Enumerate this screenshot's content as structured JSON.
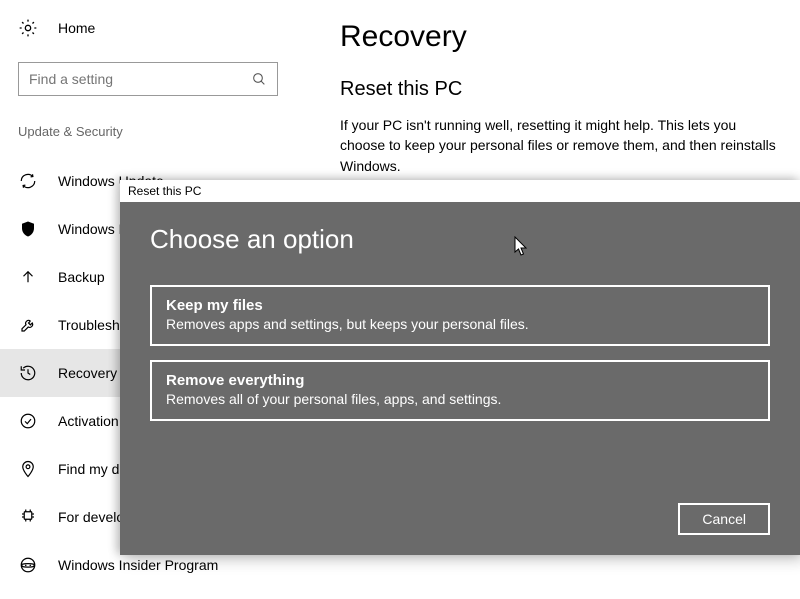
{
  "sidebar": {
    "home_label": "Home",
    "search_placeholder": "Find a setting",
    "section_label": "Update & Security",
    "items": [
      {
        "label": "Windows Update"
      },
      {
        "label": "Windows Defender"
      },
      {
        "label": "Backup"
      },
      {
        "label": "Troubleshoot"
      },
      {
        "label": "Recovery"
      },
      {
        "label": "Activation"
      },
      {
        "label": "Find my device"
      },
      {
        "label": "For developers"
      },
      {
        "label": "Windows Insider Program"
      }
    ]
  },
  "main": {
    "title": "Recovery",
    "subheading": "Reset this PC",
    "body": "If your PC isn't running well, resetting it might help. This lets you choose to keep your personal files or remove them, and then reinstalls Windows."
  },
  "modal": {
    "window_title": "Reset this PC",
    "heading": "Choose an option",
    "options": [
      {
        "title": "Keep my files",
        "desc": "Removes apps and settings, but keeps your personal files."
      },
      {
        "title": "Remove everything",
        "desc": "Removes all of your personal files, apps, and settings."
      }
    ],
    "cancel_label": "Cancel"
  }
}
